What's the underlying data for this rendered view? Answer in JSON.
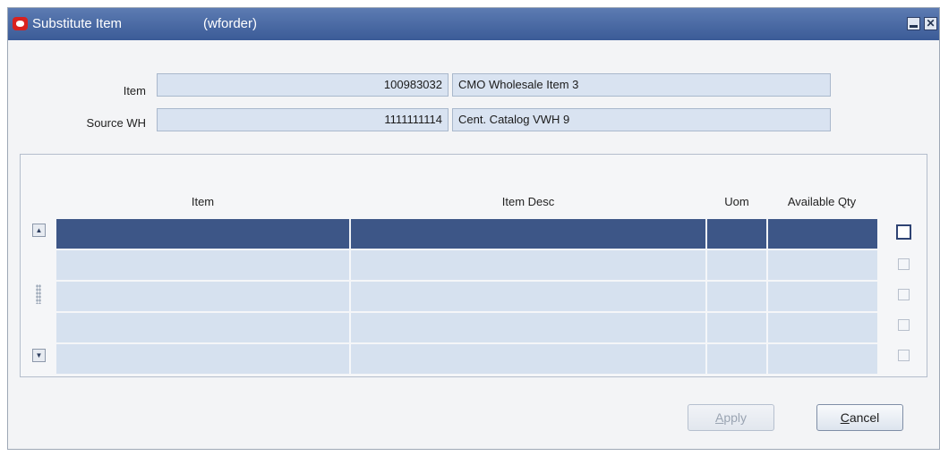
{
  "window": {
    "title": "Substitute Item",
    "context": "(wforder)"
  },
  "form": {
    "item_label": "Item",
    "item_number": "100983032",
    "item_desc": "CMO Wholesale Item 3",
    "source_wh_label": "Source WH",
    "source_wh_number": "1111111114",
    "source_wh_desc": "Cent. Catalog VWH 9"
  },
  "table": {
    "headers": [
      "Item",
      "Item Desc",
      "Uom",
      "Available Qty"
    ],
    "rows": [
      {
        "item": "",
        "desc": "",
        "uom": "",
        "qty": "",
        "selected": true,
        "checked": false
      },
      {
        "item": "",
        "desc": "",
        "uom": "",
        "qty": "",
        "selected": false,
        "checked": false
      },
      {
        "item": "",
        "desc": "",
        "uom": "",
        "qty": "",
        "selected": false,
        "checked": false
      },
      {
        "item": "",
        "desc": "",
        "uom": "",
        "qty": "",
        "selected": false,
        "checked": false
      },
      {
        "item": "",
        "desc": "",
        "uom": "",
        "qty": "",
        "selected": false,
        "checked": false
      }
    ]
  },
  "buttons": {
    "apply_mnemonic": "A",
    "apply_rest": "pply",
    "cancel_mnemonic": "C",
    "cancel_rest": "ancel"
  },
  "colors": {
    "titlebar": "#3b5b97",
    "selected_row": "#3d5687",
    "field_bg": "#d9e3f1"
  }
}
